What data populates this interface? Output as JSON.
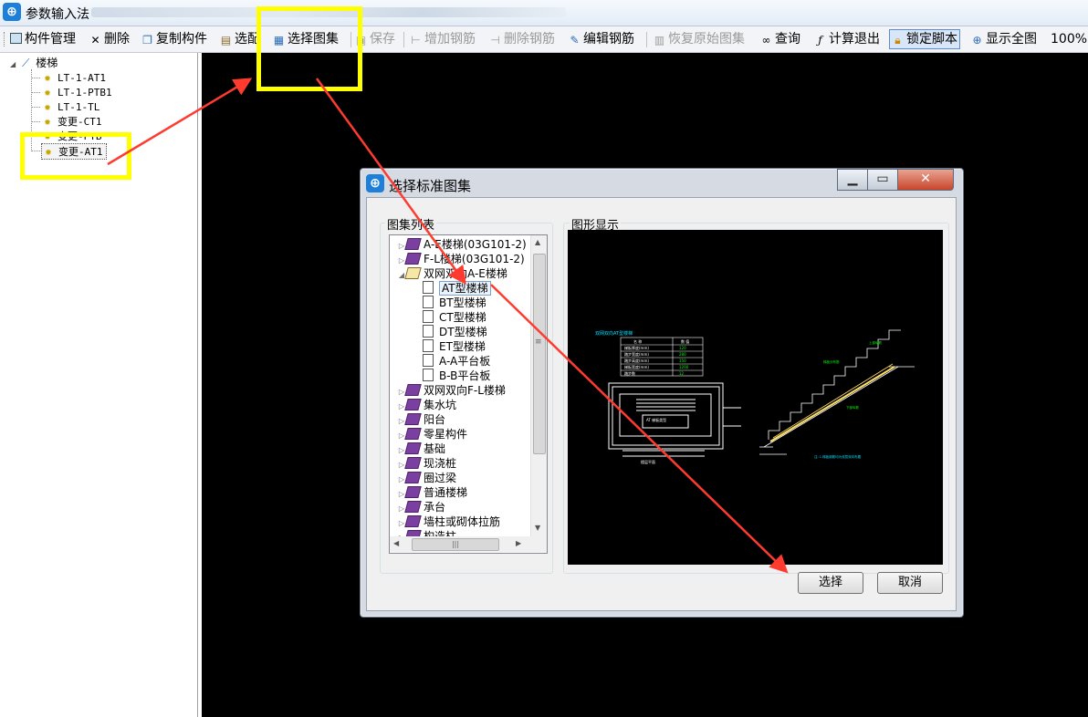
{
  "app": {
    "icon": "app-logo-icon",
    "title": "参数输入法"
  },
  "toolbar": {
    "items": [
      {
        "label": "构件管理",
        "icon": "component-manage-icon",
        "state": "normal"
      },
      {
        "label": "删除",
        "icon": "delete-x-icon",
        "state": "normal"
      },
      {
        "label": "复制构件",
        "icon": "copy-icon",
        "state": "normal"
      },
      {
        "label": "选配",
        "icon": "select-config-icon",
        "state": "normal"
      },
      {
        "label": "选择图集",
        "icon": "atlas-icon",
        "state": "normal"
      },
      {
        "label": "保存",
        "icon": "save-icon",
        "state": "disabled"
      },
      {
        "label": "增加钢筋",
        "icon": "add-rebar-icon",
        "state": "disabled"
      },
      {
        "label": "删除钢筋",
        "icon": "delete-rebar-icon",
        "state": "disabled"
      },
      {
        "label": "编辑钢筋",
        "icon": "edit-rebar-icon",
        "state": "normal"
      },
      {
        "label": "恢复原始图集",
        "icon": "restore-icon",
        "state": "disabled"
      },
      {
        "label": "查询",
        "icon": "binoculars-icon",
        "state": "normal"
      },
      {
        "label": "计算退出",
        "icon": "fx-icon",
        "state": "normal"
      },
      {
        "label": "锁定脚本",
        "icon": "lock-icon",
        "state": "pressed"
      },
      {
        "label": "显示全图",
        "icon": "zoom-icon",
        "state": "normal"
      },
      {
        "label": "100%",
        "icon": "",
        "state": "normal"
      }
    ]
  },
  "tree": {
    "root": "楼梯",
    "children": [
      "LT-1-AT1",
      "LT-1-PTB1",
      "LT-1-TL",
      "变更-CT1",
      "变更-PTB",
      "变更-AT1"
    ]
  },
  "dialog": {
    "title": "选择标准图集",
    "list_group_label": "图集列表",
    "preview_group_label": "图形显示",
    "list_items": [
      {
        "label": "A-E楼梯(03G101-2)",
        "level": 0,
        "expander": "▷",
        "icon": "book"
      },
      {
        "label": "F-L楼梯(03G101-2)",
        "level": 0,
        "expander": "▷",
        "icon": "book"
      },
      {
        "label": "双网双向A-E楼梯",
        "level": 0,
        "expander": "◢",
        "icon": "open-book"
      },
      {
        "label": "AT型楼梯",
        "level": 1,
        "expander": "",
        "icon": "doc",
        "selected": true
      },
      {
        "label": "BT型楼梯",
        "level": 1,
        "expander": "",
        "icon": "doc"
      },
      {
        "label": "CT型楼梯",
        "level": 1,
        "expander": "",
        "icon": "doc"
      },
      {
        "label": "DT型楼梯",
        "level": 1,
        "expander": "",
        "icon": "doc"
      },
      {
        "label": "ET型楼梯",
        "level": 1,
        "expander": "",
        "icon": "doc"
      },
      {
        "label": "A-A平台板",
        "level": 1,
        "expander": "",
        "icon": "doc"
      },
      {
        "label": "B-B平台板",
        "level": 1,
        "expander": "",
        "icon": "doc"
      },
      {
        "label": "双网双向F-L楼梯",
        "level": 0,
        "expander": "▷",
        "icon": "book"
      },
      {
        "label": "集水坑",
        "level": 0,
        "expander": "▷",
        "icon": "book"
      },
      {
        "label": "阳台",
        "level": 0,
        "expander": "▷",
        "icon": "book"
      },
      {
        "label": "零星构件",
        "level": 0,
        "expander": "▷",
        "icon": "book"
      },
      {
        "label": "基础",
        "level": 0,
        "expander": "▷",
        "icon": "book"
      },
      {
        "label": "现浇桩",
        "level": 0,
        "expander": "▷",
        "icon": "book"
      },
      {
        "label": "圈过梁",
        "level": 0,
        "expander": "▷",
        "icon": "book"
      },
      {
        "label": "普通楼梯",
        "level": 0,
        "expander": "▷",
        "icon": "book"
      },
      {
        "label": "承台",
        "level": 0,
        "expander": "▷",
        "icon": "book"
      },
      {
        "label": "墙柱或砌体拉筋",
        "level": 0,
        "expander": "▷",
        "icon": "book"
      },
      {
        "label": "构造柱",
        "level": 0,
        "expander": "▷",
        "icon": "book"
      }
    ],
    "preview": {
      "heading": "双网双向AT型楼梯",
      "table_headers": [
        "名 称",
        "数 值"
      ],
      "table_rows": [
        [
          "梯板厚度(mm)",
          "120"
        ],
        [
          "踏步宽度(mm)",
          "280"
        ],
        [
          "踏步高度(mm)",
          "150"
        ],
        [
          "梯板宽度(mm)",
          "1200"
        ],
        [
          "踏步数",
          "12"
        ]
      ],
      "labels": [
        "AT 梯板类型",
        "楼层平面",
        "梯板分布筋",
        "下部纵筋",
        "上部纵筋",
        "注: 1.梯板钢筋均为双层双向布置"
      ]
    },
    "select_label": "选择",
    "cancel_label": "取消",
    "minimize_icon": "minimize-icon",
    "maximize_icon": "maximize-icon",
    "close_icon": "close-icon"
  },
  "annotations": {
    "highlight_color": "#ffff00",
    "arrow_color": "#ff3b30"
  }
}
